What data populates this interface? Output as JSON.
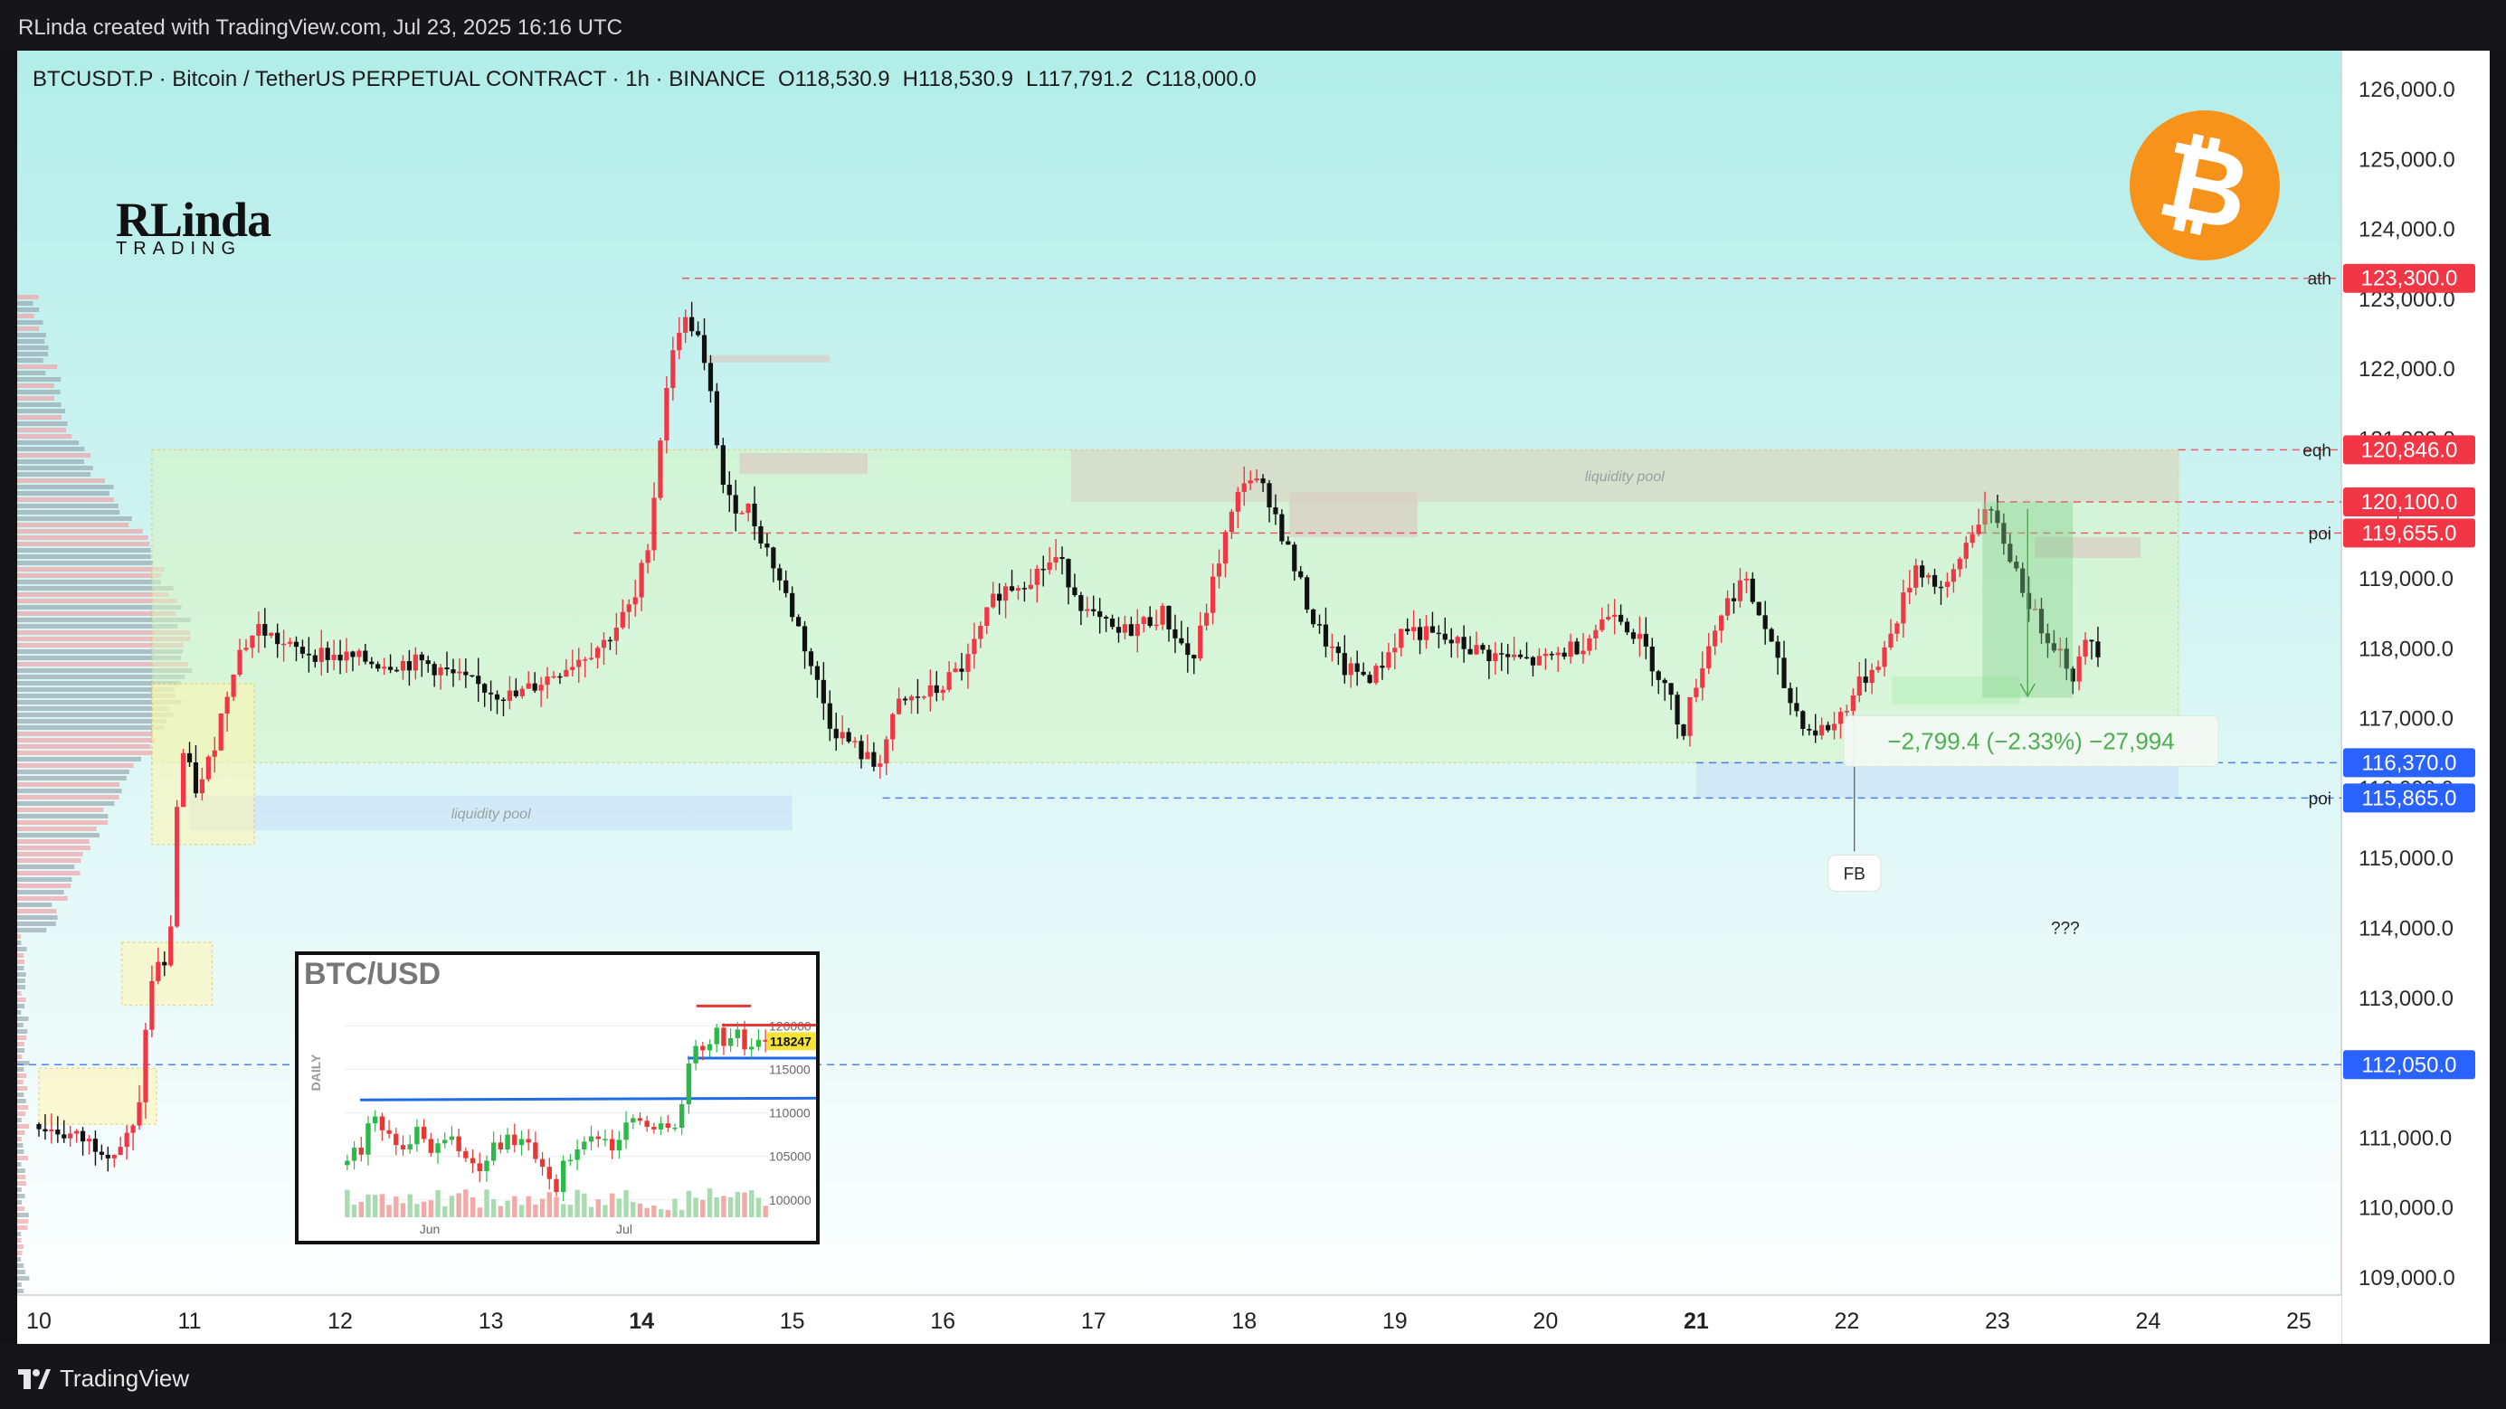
{
  "header": {
    "attribution": "RLinda created with TradingView.com, Jul 23, 2025 16:16 UTC"
  },
  "symbol_info": {
    "name": "BTCUSDT.P · Bitcoin / TetherUS PERPETUAL CONTRACT · 1h · BINANCE",
    "open": "O118,530.9",
    "high": "H118,530.9",
    "low": "L117,791.2",
    "close": "C118,000.0"
  },
  "brand": {
    "line1": "RLinda",
    "line2": "TRADING"
  },
  "footer": {
    "platform": "TradingView"
  },
  "colors": {
    "up": "#f23645",
    "down": "#111111",
    "bg_top": "#b2ede9",
    "bg_bottom": "#ffffff",
    "red_tag": "#f23645",
    "blue_tag": "#2962ff",
    "zone": "#d8f5c4",
    "btc": "#f7931a"
  },
  "chart_data": [
    {
      "type": "candlestick",
      "title": "BTCUSDT.P · Bitcoin / TetherUS PERPETUAL CONTRACT · 1h · BINANCE",
      "x_ticks": [
        "10",
        "11",
        "12",
        "13",
        "14",
        "15",
        "16",
        "17",
        "18",
        "19",
        "20",
        "21",
        "22",
        "23",
        "24",
        "25"
      ],
      "x_ticks_bold": [
        "14",
        "21"
      ],
      "y_ticks": [
        "109,000.0",
        "110,000.0",
        "111,000.0",
        "112,000.0",
        "113,000.0",
        "114,000.0",
        "115,000.0",
        "116,000.0",
        "117,000.0",
        "118,000.0",
        "119,000.0",
        "120,000.0",
        "121,000.0",
        "122,000.0",
        "123,000.0",
        "124,000.0",
        "125,000.0",
        "126,000.0"
      ],
      "y_tick_values": [
        109000,
        110000,
        111000,
        112000,
        113000,
        114000,
        115000,
        116000,
        117000,
        118000,
        119000,
        120000,
        121000,
        122000,
        123000,
        124000,
        125000,
        126000
      ],
      "ylim": [
        108600,
        126500
      ],
      "xlim_days": [
        9.85,
        25.5
      ],
      "price_path": [
        [
          10.0,
          111200
        ],
        [
          10.3,
          111000
        ],
        [
          10.55,
          110800
        ],
        [
          10.7,
          111200
        ],
        [
          10.75,
          112600
        ],
        [
          10.82,
          113600
        ],
        [
          10.9,
          113300
        ],
        [
          10.95,
          115600
        ],
        [
          11.0,
          116500
        ],
        [
          11.1,
          115900
        ],
        [
          11.2,
          116600
        ],
        [
          11.35,
          117900
        ],
        [
          11.5,
          118300
        ],
        [
          11.7,
          118000
        ],
        [
          12.0,
          117900
        ],
        [
          12.3,
          117800
        ],
        [
          12.6,
          117800
        ],
        [
          12.9,
          117500
        ],
        [
          13.2,
          117300
        ],
        [
          13.5,
          117700
        ],
        [
          13.8,
          118100
        ],
        [
          14.0,
          118700
        ],
        [
          14.1,
          119700
        ],
        [
          14.2,
          121700
        ],
        [
          14.3,
          122700
        ],
        [
          14.4,
          122600
        ],
        [
          14.5,
          121600
        ],
        [
          14.6,
          120100
        ],
        [
          14.75,
          120000
        ],
        [
          14.9,
          119300
        ],
        [
          15.1,
          118200
        ],
        [
          15.3,
          116900
        ],
        [
          15.45,
          116600
        ],
        [
          15.6,
          116300
        ],
        [
          15.75,
          117200
        ],
        [
          16.0,
          117400
        ],
        [
          16.2,
          117800
        ],
        [
          16.4,
          118800
        ],
        [
          16.6,
          119000
        ],
        [
          16.8,
          119300
        ],
        [
          17.0,
          118500
        ],
        [
          17.2,
          118200
        ],
        [
          17.5,
          118500
        ],
        [
          17.7,
          117800
        ],
        [
          17.9,
          119500
        ],
        [
          18.05,
          120500
        ],
        [
          18.2,
          120200
        ],
        [
          18.35,
          119300
        ],
        [
          18.5,
          118400
        ],
        [
          18.7,
          117700
        ],
        [
          18.9,
          117600
        ],
        [
          19.1,
          118300
        ],
        [
          19.4,
          118100
        ],
        [
          19.7,
          117900
        ],
        [
          20.0,
          117800
        ],
        [
          20.3,
          118100
        ],
        [
          20.5,
          118600
        ],
        [
          20.7,
          118000
        ],
        [
          20.85,
          117400
        ],
        [
          20.95,
          116800
        ],
        [
          21.05,
          117600
        ],
        [
          21.2,
          118500
        ],
        [
          21.35,
          119000
        ],
        [
          21.5,
          118300
        ],
        [
          21.65,
          117300
        ],
        [
          21.8,
          116800
        ],
        [
          21.95,
          116900
        ],
        [
          22.1,
          117400
        ],
        [
          22.3,
          118000
        ],
        [
          22.5,
          119200
        ],
        [
          22.7,
          118800
        ],
        [
          22.85,
          119600
        ],
        [
          22.95,
          120000
        ],
        [
          23.05,
          119700
        ],
        [
          23.15,
          119200
        ],
        [
          23.3,
          118400
        ],
        [
          23.45,
          118000
        ],
        [
          23.55,
          117600
        ],
        [
          23.65,
          118200
        ],
        [
          23.7,
          118000
        ]
      ],
      "volume_profile": "horizontal, left edge",
      "levels": [
        {
          "label": "ath",
          "price": 123300,
          "tag": "123,300.0",
          "color": "red",
          "style": "dashed",
          "x_from": 14.27
        },
        {
          "label": "eqh",
          "price": 120846,
          "tag": "120,846.0",
          "color": "red",
          "style": "dashed",
          "x_from": 24.2
        },
        {
          "label": "",
          "price": 120100,
          "tag": "120,100.0",
          "color": "red",
          "style": "dashed",
          "x_from": 23.0
        },
        {
          "label": "poi",
          "price": 119655,
          "tag": "119,655.0",
          "color": "red",
          "style": "dashed",
          "x_from": 13.55
        },
        {
          "label": "",
          "price": 116370,
          "tag": "116,370.0",
          "color": "blue",
          "style": "dashed",
          "x_from": 21.0
        },
        {
          "label": "poi",
          "price": 115865,
          "tag": "115,865.0",
          "color": "blue",
          "style": "dashed",
          "x_from": 15.6
        },
        {
          "label": "",
          "price": 112050,
          "tag": "112,050.0",
          "color": "blue",
          "style": "dashed",
          "x_from": 9.85
        }
      ],
      "zones": [
        {
          "kind": "range",
          "from_day": 10.75,
          "to_day": 24.2,
          "low": 116370,
          "high": 120846
        },
        {
          "kind": "liquidity pool",
          "label": "liquidity pool",
          "from_day": 16.85,
          "to_day": 24.2,
          "low": 120100,
          "high": 120846
        },
        {
          "kind": "liquidity pool",
          "label": "liquidity pool",
          "from_day": 11.0,
          "to_day": 15.0,
          "low": 115400,
          "high": 115900
        },
        {
          "kind": "liquidity",
          "label": "",
          "from_day": 21.0,
          "to_day": 24.2,
          "low": 115865,
          "high": 116370
        }
      ],
      "measurement": {
        "text": "−2,799.4 (−2.33%) −27,994",
        "from_price": 120100,
        "to_price": 117300
      },
      "annotations": [
        "FB",
        "???"
      ]
    },
    {
      "type": "candlestick",
      "title": "BTC/USD",
      "timeframe": "DAILY",
      "x_ticks": [
        "Jun",
        "Jul"
      ],
      "y_ticks": [
        "120000",
        "115000",
        "110000",
        "105000",
        "100000"
      ],
      "last_price": "118247",
      "ylim": [
        98000,
        124000
      ],
      "closes": [
        104500,
        106000,
        105200,
        108800,
        109600,
        108000,
        107600,
        106300,
        105800,
        106400,
        108400,
        107000,
        105400,
        106500,
        106900,
        107300,
        105600,
        104800,
        104200,
        103300,
        104500,
        106600,
        105800,
        107500,
        106300,
        107000,
        106600,
        104700,
        103800,
        102400,
        100900,
        104500,
        104600,
        105800,
        106700,
        107300,
        107000,
        107000,
        105700,
        106900,
        108900,
        109400,
        109100,
        108400,
        108100,
        108800,
        108300,
        108300,
        111000,
        115700,
        117700,
        117200,
        117900,
        119800,
        117700,
        118600,
        119600,
        117300,
        117600,
        118400,
        118200
      ]
    }
  ]
}
